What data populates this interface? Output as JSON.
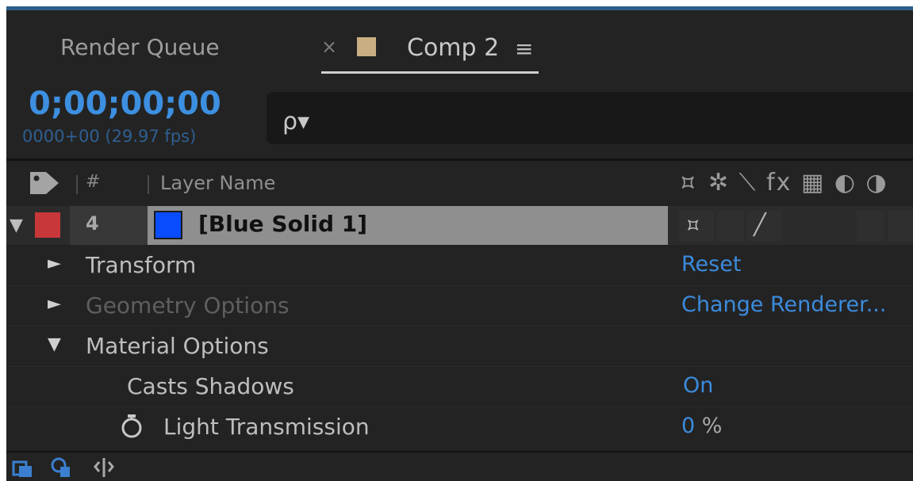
{
  "tabs": {
    "render_queue_label": "Render Queue",
    "close_glyph": "×",
    "comp_label": "Comp 2",
    "menu_glyph": "≡",
    "comp_swatch_color": "#c8ae82"
  },
  "time": {
    "timecode": "0;00;00;00",
    "frame_fps": "0000+00 (29.97 fps)"
  },
  "search": {
    "icon": "search-icon",
    "glyph": "ρ▾"
  },
  "columns": {
    "number_header": "#",
    "name_header": "Layer Name",
    "switch_icons": [
      "shy-icon",
      "collapse-icon",
      "quality-icon",
      "effects-icon",
      "frame-blend-icon",
      "motion-blur-icon",
      "adjustment-icon"
    ],
    "switch_glyphs": "⯏ ✲ ⟍ fx ▦ ◐ ◑"
  },
  "layer": {
    "expanded_glyph": "▼",
    "label_color": "#c8373a",
    "number": "4",
    "solid_color": "#0a4cff",
    "name": "[Blue Solid 1]",
    "shy_glyph": "⯏",
    "quality_glyph": "╱"
  },
  "properties": {
    "transform": {
      "label": "Transform",
      "value": "Reset",
      "expander": "►"
    },
    "geometry": {
      "label": "Geometry Options",
      "value": "Change Renderer...",
      "expander": "►"
    },
    "material": {
      "label": "Material Options",
      "expander": "▼"
    },
    "casts_shadows": {
      "label": "Casts Shadows",
      "value": "On"
    },
    "light_transmission": {
      "label": "Light Transmission",
      "value": "0",
      "unit": "%"
    }
  },
  "bottom_bar": {
    "icons": [
      "comp-button-icon",
      "layer-switches-icon",
      "transfer-controls-icon"
    ]
  }
}
